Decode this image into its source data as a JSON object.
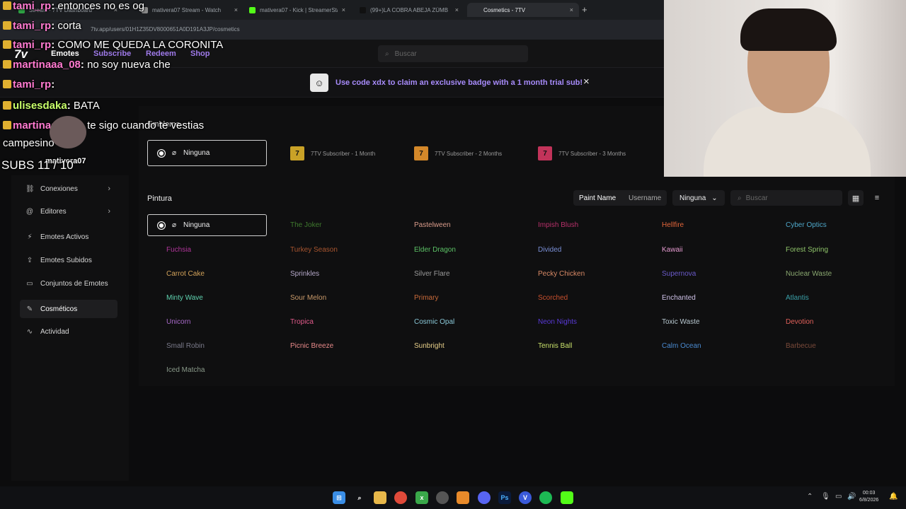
{
  "browser": {
    "tabs": [
      {
        "title": "Stream - 7TV Dashboard",
        "color": "#2ea043"
      },
      {
        "title": "mativera07 Stream - Watch",
        "color": "#888888"
      },
      {
        "title": "mativera07 - Kick | StreamerSta",
        "color": "#53fc18"
      },
      {
        "title": "(99+)LA COBRA ABEJA ZÚMBA",
        "color": "#111111"
      },
      {
        "title": "Cosmetics - 7TV",
        "color": "#2a2c30"
      }
    ],
    "url": "7tv.app/users/01H1Z35DV8000651A0D191A3JP/cosmetics"
  },
  "nav": {
    "logo": "7v",
    "links": [
      "Emotes",
      "Subscribe",
      "Redeem",
      "Shop"
    ],
    "search_placeholder": "Buscar"
  },
  "banner": {
    "text": "Use code xdx to claim an exclusive badge with a 1 month trial sub!",
    "close": "×"
  },
  "sidebar": {
    "items": [
      {
        "label": "Conexiones",
        "icon": "link-icon",
        "glyph": "⛓"
      },
      {
        "label": "Editores",
        "icon": "at-icon",
        "glyph": "@"
      },
      {
        "label": "Emotes Activos",
        "icon": "bolt-icon",
        "glyph": "⚡"
      },
      {
        "label": "Emotes Subidos",
        "icon": "upload-icon",
        "glyph": "⇪"
      },
      {
        "label": "Conjuntos de Emotes",
        "icon": "folder-icon",
        "glyph": "▭"
      },
      {
        "label": "Cosméticos",
        "icon": "brush-icon",
        "glyph": "✎"
      },
      {
        "label": "Actividad",
        "icon": "activity-icon",
        "glyph": "∿"
      }
    ]
  },
  "emblema": {
    "title": "Emblema",
    "none_label": "Ninguna",
    "badges": [
      {
        "label": "7TV Subscriber - 1 Month",
        "color": "#c9a227"
      },
      {
        "label": "7TV Subscriber - 2 Months",
        "color": "#d4882a"
      },
      {
        "label": "7TV Subscriber - 3 Months",
        "color": "#c2335a"
      }
    ]
  },
  "pintura": {
    "title": "Pintura",
    "view_options": [
      "Paint Name",
      "Username"
    ],
    "filter_value": "Ninguna",
    "search_placeholder": "Buscar",
    "none_label": "Ninguna",
    "paints": [
      {
        "name": "The Joker",
        "color": "#3f7a2e"
      },
      {
        "name": "Pastelween",
        "color": "#d99b8a"
      },
      {
        "name": "Impish Blush",
        "color": "#b8306a"
      },
      {
        "name": "Hellfire",
        "color": "#e0653a"
      },
      {
        "name": "Cyber Optics",
        "color": "#4ea7c9"
      },
      {
        "name": "Fuchsia",
        "color": "#b0359a"
      },
      {
        "name": "Turkey Season",
        "color": "#a8552f"
      },
      {
        "name": "Elder Dragon",
        "color": "#5cc266"
      },
      {
        "name": "Divided",
        "color": "#7a8fd6"
      },
      {
        "name": "Kawaii",
        "color": "#e59ad0"
      },
      {
        "name": "Forest Spring",
        "color": "#8fc46a"
      },
      {
        "name": "Carrot Cake",
        "color": "#d3a35a"
      },
      {
        "name": "Sprinkles",
        "color": "#b5a8c9"
      },
      {
        "name": "Silver Flare",
        "color": "#9a9a9a"
      },
      {
        "name": "Pecky Chicken",
        "color": "#d98a66"
      },
      {
        "name": "Supernova",
        "color": "#6a5ac9"
      },
      {
        "name": "Nuclear Waste",
        "color": "#8aa870"
      },
      {
        "name": "Minty Wave",
        "color": "#5fd3b0"
      },
      {
        "name": "Sour Melon",
        "color": "#c99a6a"
      },
      {
        "name": "Primary",
        "color": "#c96a3a"
      },
      {
        "name": "Scorched",
        "color": "#c9502e"
      },
      {
        "name": "Enchanted",
        "color": "#cfc2e8"
      },
      {
        "name": "Atlantis",
        "color": "#3aa0a8"
      },
      {
        "name": "Unicorn",
        "color": "#a86ac9"
      },
      {
        "name": "Tropica",
        "color": "#e05a8a"
      },
      {
        "name": "Cosmic Opal",
        "color": "#8ac9d9"
      },
      {
        "name": "Neon Nights",
        "color": "#5a3ad9"
      },
      {
        "name": "Toxic Waste",
        "color": "#b8c8d0"
      },
      {
        "name": "Devotion",
        "color": "#e0605a"
      },
      {
        "name": "Small Robin",
        "color": "#7a7a8a"
      },
      {
        "name": "Picnic Breeze",
        "color": "#e88a8a"
      },
      {
        "name": "Sunbright",
        "color": "#e8d08a"
      },
      {
        "name": "Tennis Ball",
        "color": "#c8e06a"
      },
      {
        "name": "Calm Ocean",
        "color": "#4a8ad0"
      },
      {
        "name": "Barbecue",
        "color": "#7a4a3a"
      },
      {
        "name": "Iced Matcha",
        "color": "#8a9a8a"
      }
    ]
  },
  "chat": [
    {
      "user": "tami_rp",
      "msg": "entonces no es og",
      "color": "#ff7ad0"
    },
    {
      "user": "tami_rp",
      "msg": "corta",
      "color": "#ff7ad0"
    },
    {
      "user": "tami_rp",
      "msg": "COMO ME QUEDA LA CORONITA",
      "color": "#ff7ad0"
    },
    {
      "user": "martinaaa_08",
      "msg": "no soy nueva che",
      "color": "#ff7ad0"
    },
    {
      "user": "tami_rp",
      "msg": "",
      "color": "#ff7ad0"
    },
    {
      "user": "ulisesdaka",
      "msg": "BATA",
      "color": "#c8ff6a"
    },
    {
      "user": "martinaaa_08",
      "msg": "te sigo cuando te vestias",
      "color": "#ff7ad0"
    },
    {
      "user": "",
      "msg": "campesino",
      "color": "#ffffff"
    }
  ],
  "overlay": {
    "subs": "SUBS 11 / 10",
    "name": "mativera07"
  },
  "taskbar": {
    "time": "00:03",
    "date": "6/8/2026"
  }
}
